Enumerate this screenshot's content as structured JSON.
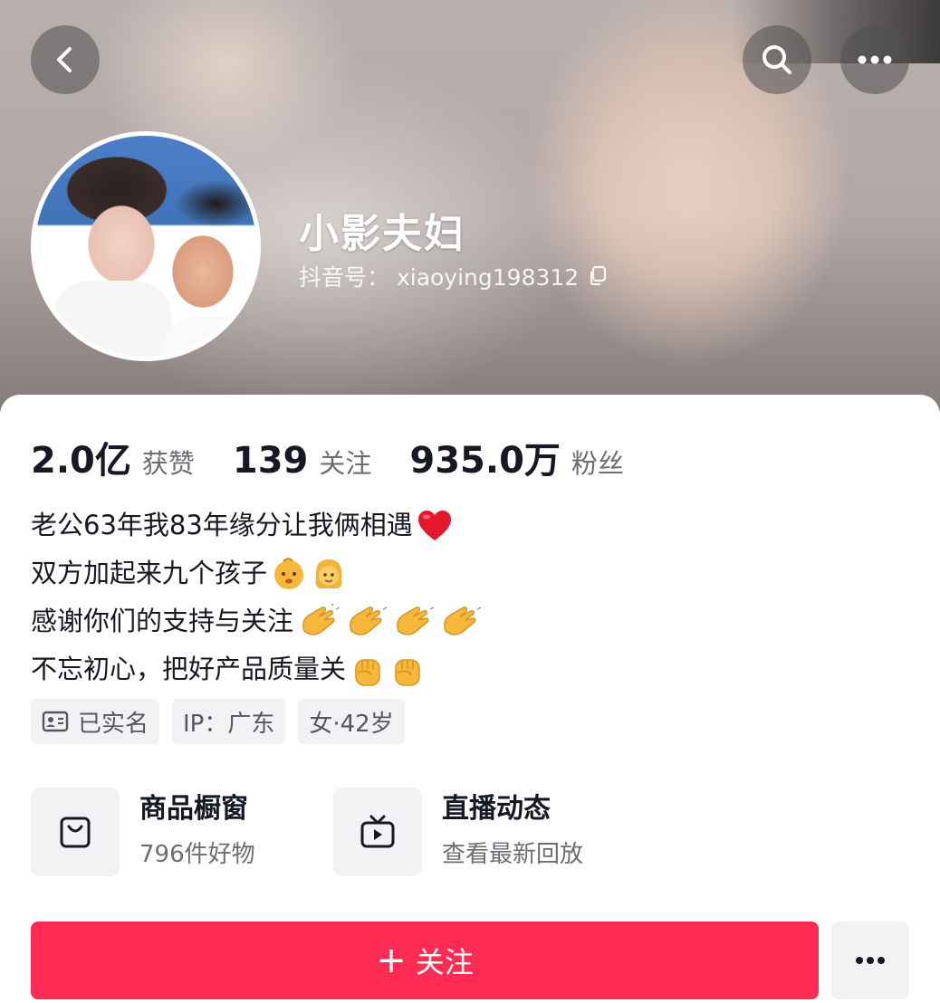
{
  "profile": {
    "nickname": "小影夫妇",
    "douyin_id": "抖音号： xiaoying198312"
  },
  "stats": [
    {
      "value": "2.0亿",
      "label": "获赞"
    },
    {
      "value": "139",
      "label": "关注"
    },
    {
      "value": "935.0万",
      "label": "粉丝"
    }
  ],
  "bio": {
    "line1": "老公63年我83年缘分让我俩相遇",
    "line2": "双方加起来九个孩子",
    "line3": "感谢你们的支持与关注",
    "line4": "不忘初心，把好产品质量关"
  },
  "tags": {
    "verified": "已实名",
    "ip": "IP：广东",
    "gender_age": "女·42岁"
  },
  "features": {
    "shop_title": "商品橱窗",
    "shop_sub": "796件好物",
    "live_title": "直播动态",
    "live_sub": "查看最新回放"
  },
  "actions": {
    "follow_plus": "+",
    "follow_label": "关注"
  },
  "icons": {
    "back": "chevron-left-icon",
    "search": "search-icon",
    "more": "more-dots-icon",
    "copy": "copy-icon",
    "heart": "red-heart-emoji",
    "baby": "baby-emoji",
    "girl": "girl-emoji",
    "clap": "clapping-hands-emoji",
    "fist": "raised-fist-emoji",
    "idcard": "id-card-icon",
    "shop": "shopping-bag-icon",
    "tv": "tv-play-icon"
  },
  "colors": {
    "accent": "#fe2c55",
    "text_primary": "#161823",
    "text_secondary": "#6b6d75",
    "chip_bg": "#f2f2f4"
  }
}
